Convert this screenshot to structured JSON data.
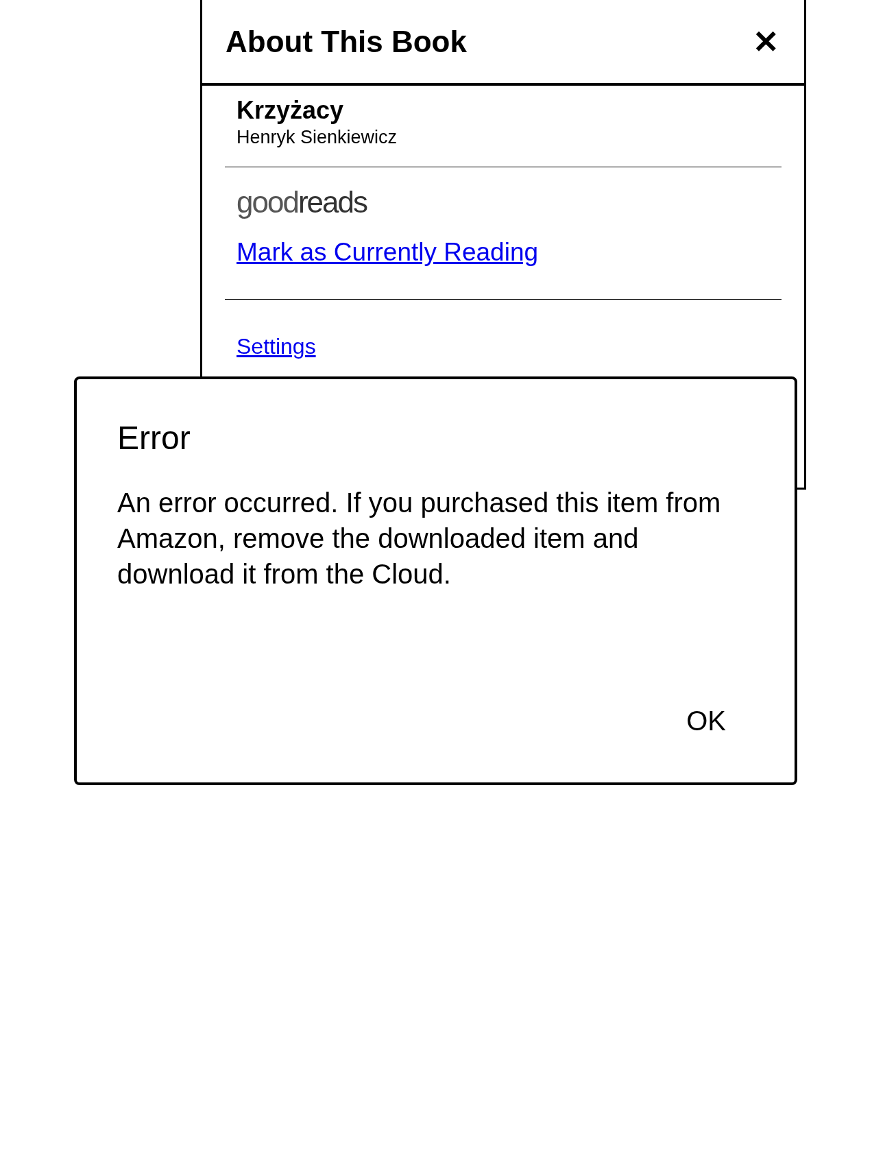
{
  "panel": {
    "title": "About This Book",
    "close": "✕",
    "book_title": "Krzyżacy",
    "author": "Henryk Sienkiewicz",
    "goodreads_logo": [
      "good",
      "reads"
    ],
    "link": "Mark as Currently Reading",
    "settings": "Settings"
  },
  "dialog": {
    "title": "Error",
    "message": "An error occurred. If you purchased this item from Amazon, remove the downloaded item and download it from the Cloud.",
    "buttons": [
      "OK"
    ]
  }
}
